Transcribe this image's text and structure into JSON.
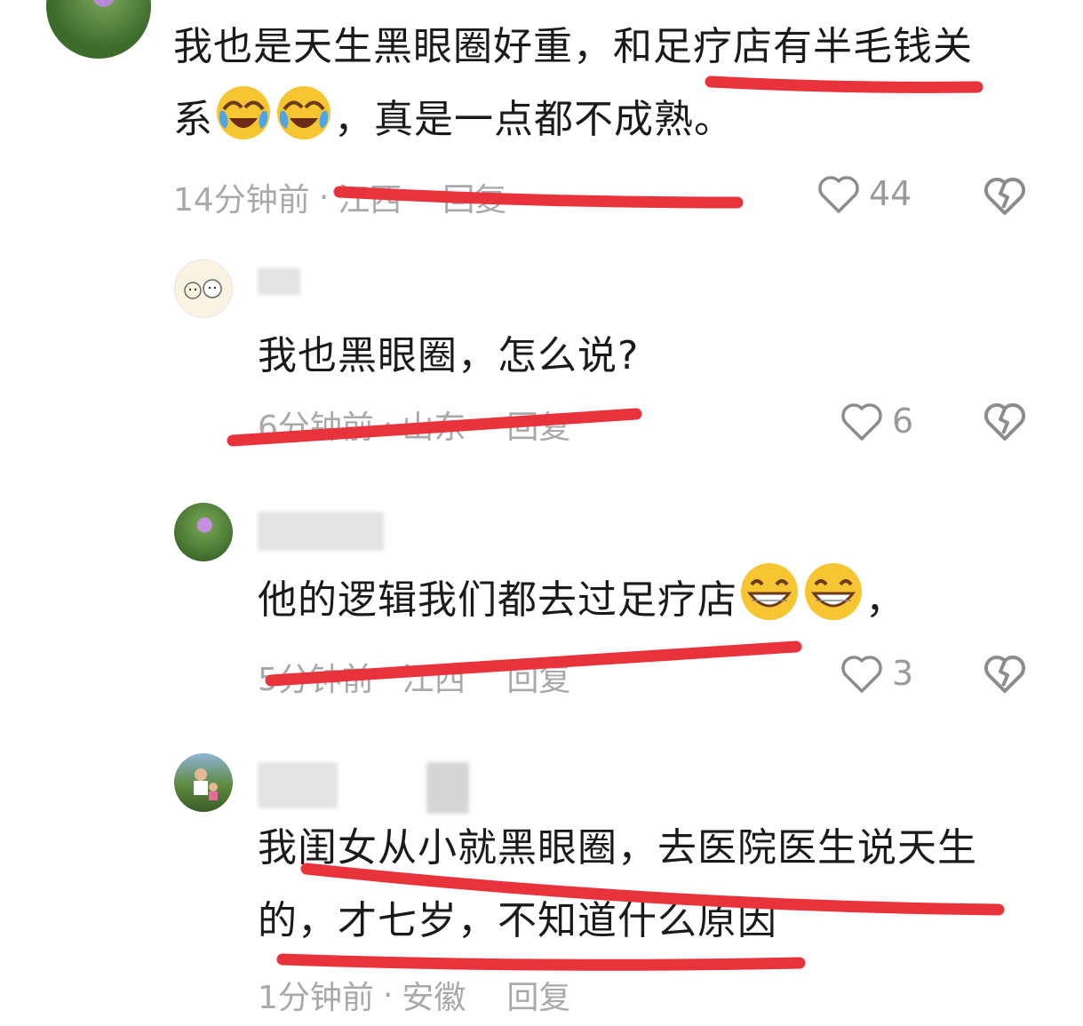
{
  "comments": [
    {
      "text_line1": "我也是天生黑眼圈好重，和足疗店有半毛钱关",
      "text_line2_before": "系",
      "text_line2_after": "，真是一点都不成熟。",
      "time": "14分钟前",
      "location": "江西",
      "reply": "回复",
      "likes": "44",
      "emoji": "face-with-tears-of-joy"
    },
    {
      "text": "我也黑眼圈，怎么说?",
      "time": "6分钟前",
      "location": "山东",
      "reply": "回复",
      "likes": "6"
    },
    {
      "text_before": "他的逻辑我们都去过足疗店",
      "text_after": "，",
      "time": "5分钟前",
      "location": "江西",
      "reply": "回复",
      "likes": "3",
      "emoji": "grinning-face"
    },
    {
      "text_line1": "我闺女从小就黑眼圈，去医院医生说天生",
      "text_line2": "的，才七岁，不知道什么原因",
      "time": "1分钟前",
      "location": "安徽",
      "reply": "回复"
    }
  ],
  "meta_separator": "·",
  "colors": {
    "annotation_red": "#e8323c",
    "meta_gray": "#a9a9a9",
    "text": "#1a1a1a"
  }
}
